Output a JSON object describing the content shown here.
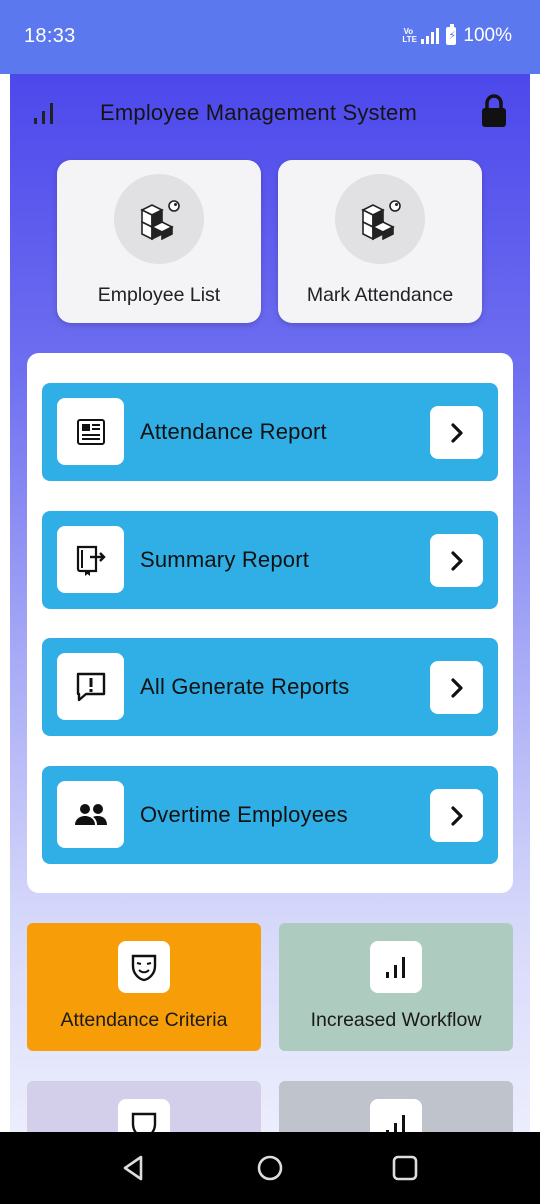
{
  "status_bar": {
    "time": "18:33",
    "network": "Vo LTE",
    "battery": "100%"
  },
  "header": {
    "title": "Employee Management System",
    "left_icon": "bar-chart-icon",
    "right_icon": "lock-icon"
  },
  "tiles": [
    {
      "label": "Employee List",
      "icon": "cubes-icon"
    },
    {
      "label": "Mark Attendance",
      "icon": "cubes-icon"
    }
  ],
  "reports": [
    {
      "label": "Attendance Report",
      "icon": "newspaper-icon"
    },
    {
      "label": "Summary Report",
      "icon": "book-export-icon"
    },
    {
      "label": "All Generate Reports",
      "icon": "alert-message-icon"
    },
    {
      "label": "Overtime Employees",
      "icon": "people-icon"
    }
  ],
  "cards": [
    {
      "label": "Attendance Criteria",
      "icon": "mask-icon",
      "color": "#f79d07"
    },
    {
      "label": "Increased Workflow",
      "icon": "bar-chart-icon",
      "color": "#aecbbf"
    },
    {
      "label": "",
      "icon": "shield-icon",
      "color": "#d3ceea"
    },
    {
      "label": "",
      "icon": "bar-chart-icon",
      "color": "#bfc3cb"
    }
  ],
  "colors": {
    "status_bar": "#5b78ee",
    "report_row": "#2fafe6",
    "nav_bar": "#000000"
  }
}
